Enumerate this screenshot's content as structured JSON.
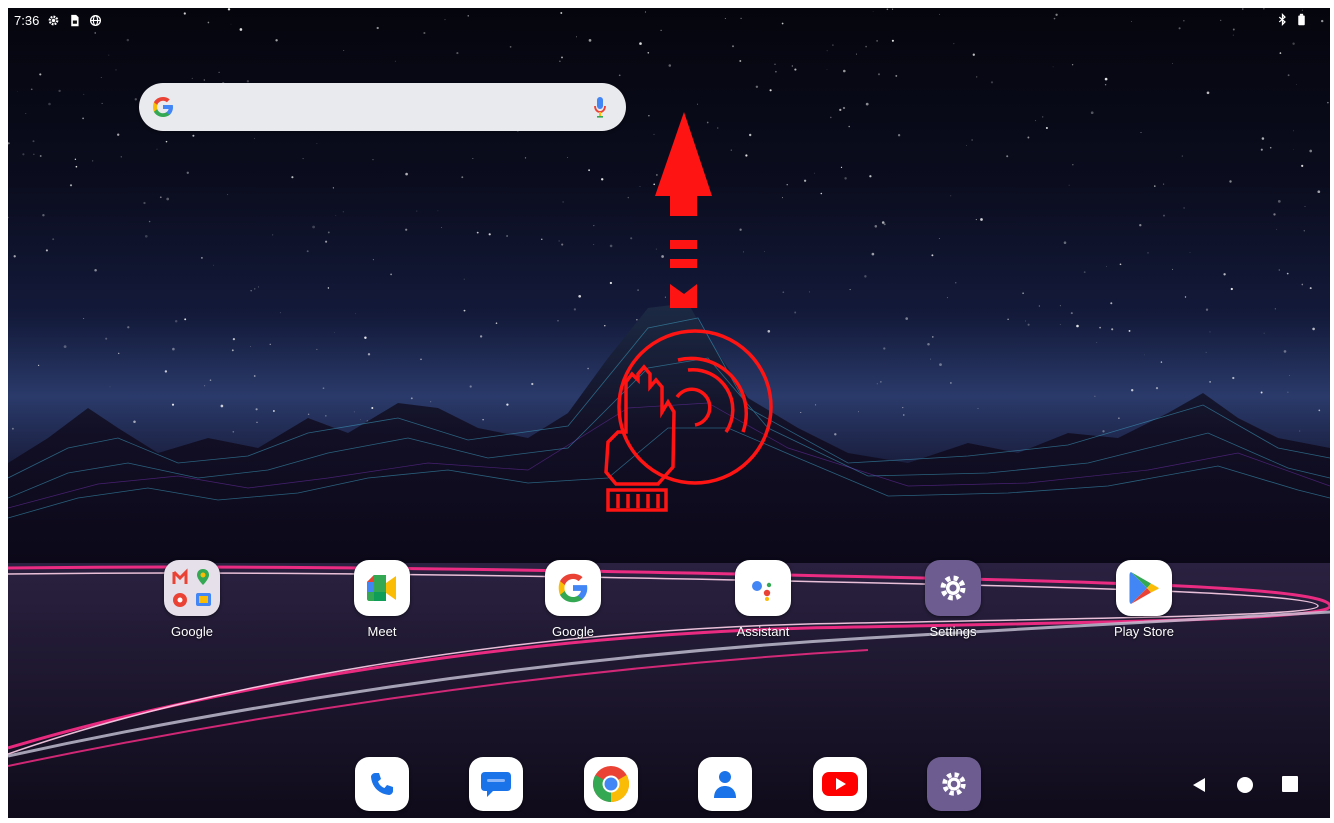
{
  "status_bar": {
    "time": "7:36",
    "left_icons": [
      "gear-icon",
      "sim-card-icon",
      "globe-icon"
    ],
    "right_icons": [
      "bluetooth-icon",
      "battery-icon"
    ]
  },
  "search_bar": {
    "logo": "google-g-icon",
    "voice": "microphone-icon"
  },
  "gesture_hint": {
    "icons": [
      "swipe-up-arrow-icon",
      "hand-swipe-icon"
    ],
    "color": "#ff1414"
  },
  "home_apps": [
    {
      "label": "Google",
      "icon": "google-folder-icon"
    },
    {
      "label": "Meet",
      "icon": "meet-icon"
    },
    {
      "label": "Google",
      "icon": "google-icon"
    },
    {
      "label": "Assistant",
      "icon": "assistant-icon"
    },
    {
      "label": "Settings",
      "icon": "settings-icon"
    },
    {
      "label": "Play Store",
      "icon": "play-store-icon"
    }
  ],
  "dock": [
    "phone-icon",
    "messages-icon",
    "chrome-icon",
    "contacts-icon",
    "youtube-icon",
    "settings-icon"
  ],
  "nav_bar": [
    "back-icon",
    "home-icon",
    "recents-icon"
  ],
  "colors": {
    "accent_red": "#ff1414",
    "google_blue": "#4285f4",
    "google_red": "#ea4335",
    "google_yellow": "#fbbc05",
    "google_green": "#34a853"
  }
}
